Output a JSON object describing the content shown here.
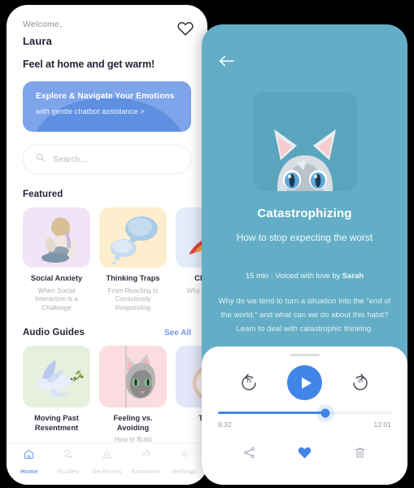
{
  "home": {
    "welcome_label": "Welcome,",
    "user_name": "Laura",
    "tagline": "Feel at home and get warm!",
    "favorite_icon": "heart-outline-icon",
    "banner": {
      "title": "Explore & Navigate Your Emotions",
      "subtitle": "with gentle chatbot assistance >",
      "bg_color": "#7ea4ea",
      "arc_color": "#5f8fe0"
    },
    "search": {
      "placeholder": "Search...",
      "value": "",
      "icon": "search-icon"
    },
    "featured": {
      "title": "Featured",
      "cards": [
        {
          "title": "Social Anxiety",
          "subtitle": "When Social Interaction is a Challenge",
          "thumb_color": "#f1e4f7",
          "art": "person-hugging-knees"
        },
        {
          "title": "Thinking Traps",
          "subtitle": "From Reacting to Consciously Responding",
          "thumb_color": "#fdeecd",
          "art": "thought-bubbles"
        },
        {
          "title": "Chasing",
          "subtitle": "Why Po Always",
          "thumb_color": "#e2ecfb",
          "art": "rainbow-arc"
        }
      ]
    },
    "audio_guides": {
      "title": "Audio Guides",
      "see_all_label": "See All",
      "cards": [
        {
          "title": "Moving Past Resentment",
          "subtitle": "",
          "thumb_color": "#e6f0dc",
          "art": "dove-olive-branch"
        },
        {
          "title": "Feeling vs. Avoiding",
          "subtitle": "How to Build Emotional",
          "thumb_color": "#fbdde1",
          "art": "cat-face"
        },
        {
          "title": "The M",
          "subtitle": "",
          "thumb_color": "#e3e6f8",
          "art": "pocket-watch"
        }
      ]
    },
    "bottom_nav": {
      "items": [
        {
          "label": "Home",
          "icon": "home-icon",
          "active": true
        },
        {
          "label": "Guides",
          "icon": "guides-icon",
          "active": false
        },
        {
          "label": "De-Stress",
          "icon": "sunrise-icon",
          "active": false
        },
        {
          "label": "Emotions",
          "icon": "emotions-icon",
          "active": false
        },
        {
          "label": "Settings",
          "icon": "gear-icon",
          "active": false
        }
      ],
      "active_color": "#6f9ae8",
      "inactive_color": "#d6dae2"
    }
  },
  "player": {
    "bg_color": "#63aec6",
    "back_icon": "arrow-left-icon",
    "hero_art": "cat-peeking",
    "title": "Catastrophizing",
    "subtitle": "How to stop expecting the worst",
    "meta_duration": "15 min",
    "meta_separator": " · ",
    "meta_voiced_prefix": "Voiced with love by ",
    "meta_voice_name": "Sarah",
    "description": "Why do we tend to turn a situation into the \"end of the world,\" and what can we do about this habit? Learn to deal with catastrophic thinking.",
    "controls": {
      "rewind_label": "15",
      "rewind_icon": "rewind-15-icon",
      "play_icon": "play-icon",
      "forward_label": "15",
      "forward_icon": "forward-15-icon",
      "accent_color": "#4285e8"
    },
    "progress": {
      "elapsed": "8:32",
      "total": "12:01",
      "percent": 62
    },
    "actions": [
      {
        "icon": "share-icon",
        "active": false
      },
      {
        "icon": "heart-filled-icon",
        "active": true
      },
      {
        "icon": "trash-icon",
        "active": false
      }
    ]
  }
}
